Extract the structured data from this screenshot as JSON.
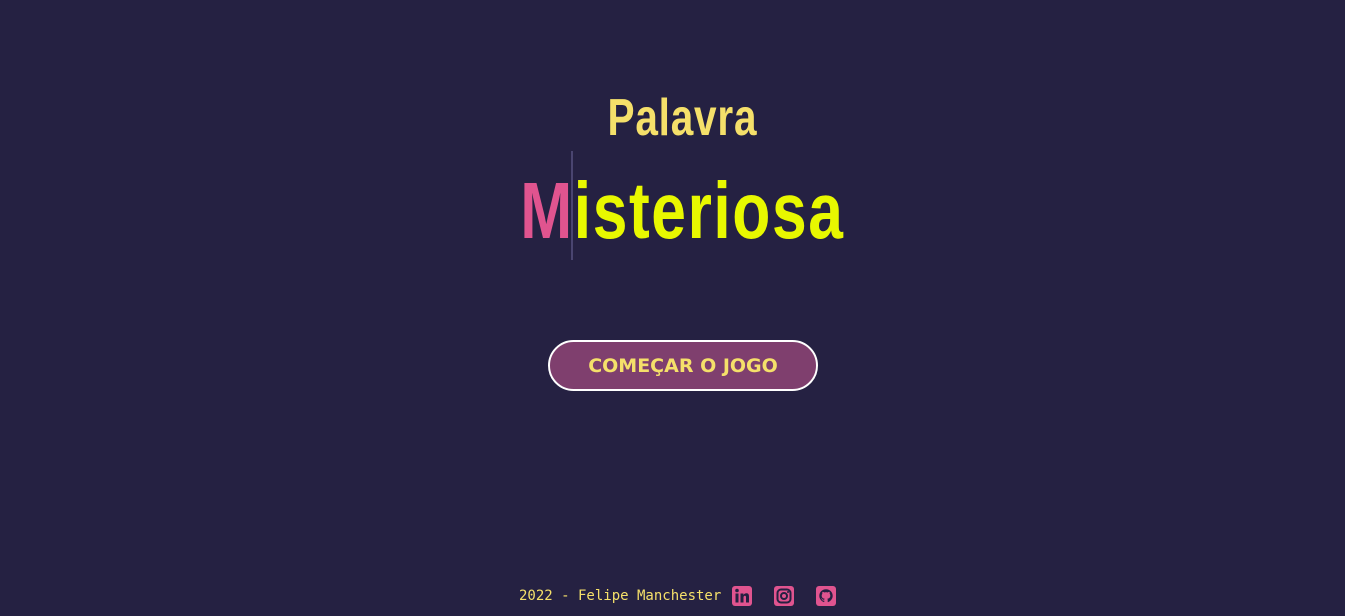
{
  "header": {
    "title_top": "Palavra",
    "title_bottom_first": "M",
    "title_bottom_rest": "isteriosa"
  },
  "main": {
    "start_button_label": "COMEÇAR O JOGO"
  },
  "footer": {
    "credit": "2022 - Felipe Manchester",
    "icons": [
      "linkedin-icon",
      "instagram-icon",
      "github-icon"
    ]
  },
  "colors": {
    "background": "#252142",
    "accent_yellow": "#f5e06a",
    "title_yellow": "#e8f800",
    "accent_pink": "#e0548f",
    "button_bg": "#7f3f6e"
  }
}
